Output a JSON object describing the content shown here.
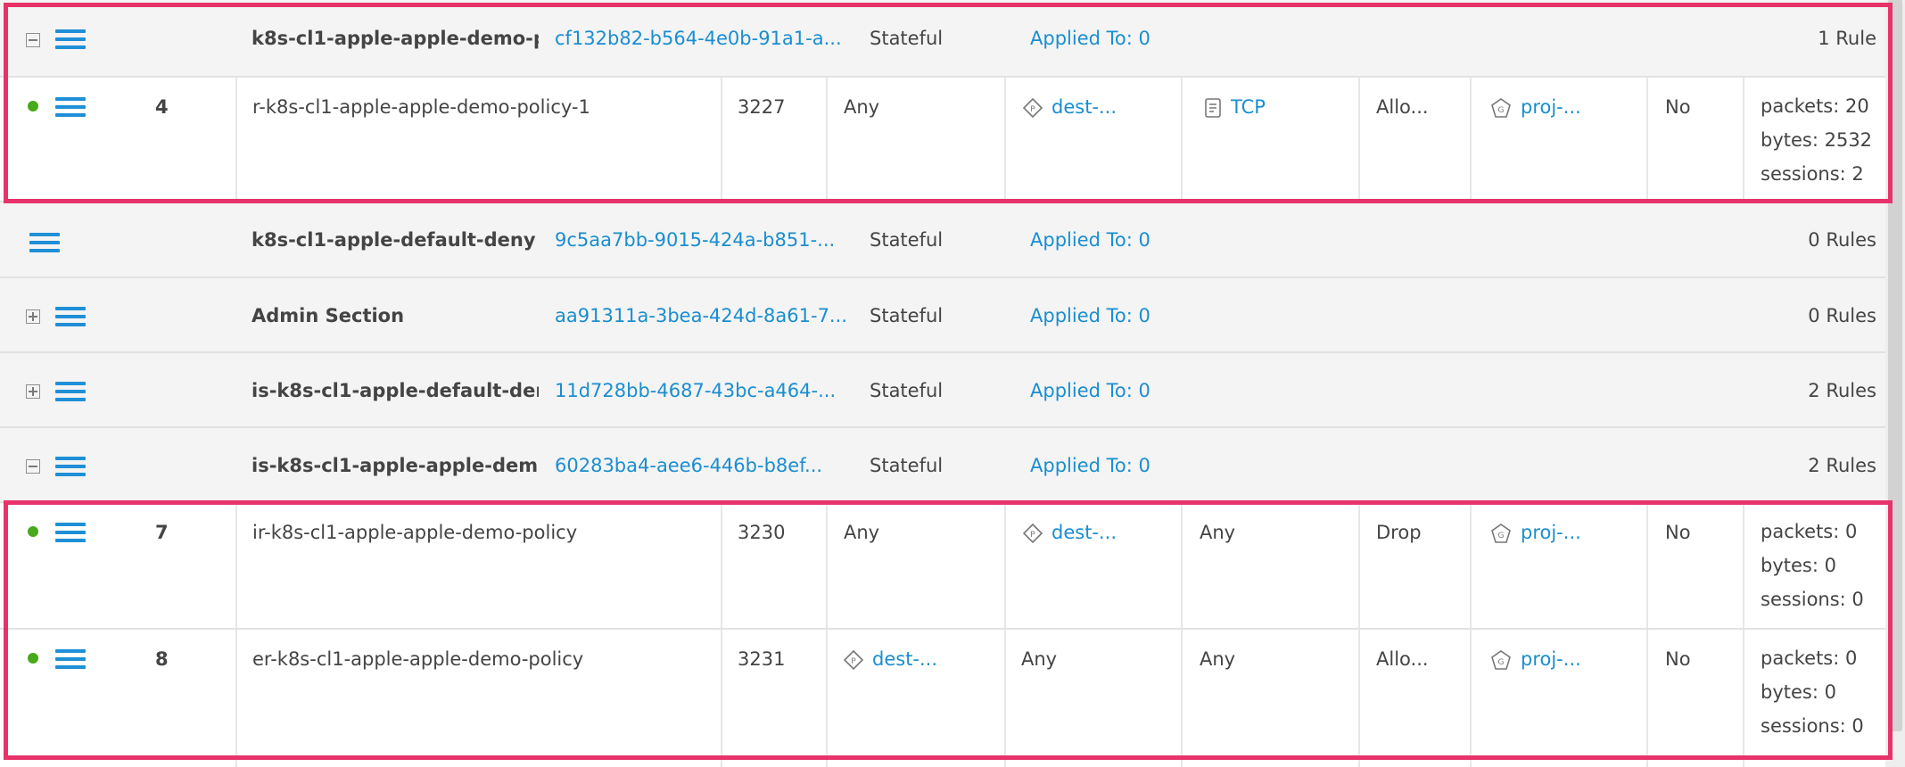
{
  "colors": {
    "accent": "#1f8fd8",
    "highlight": "#e7336a",
    "status_ok": "#48a91a"
  },
  "sections": [
    {
      "expander": "minus",
      "name": "k8s-cl1-apple-apple-demo-p",
      "id": "cf132b82-b564-4e0b-91a1-a...",
      "type": "Stateful",
      "applied": "Applied To: 0",
      "rules": "1 Rule"
    },
    {
      "expander": "none",
      "name": "k8s-cl1-apple-default-deny",
      "id": "9c5aa7bb-9015-424a-b851-...",
      "type": "Stateful",
      "applied": "Applied To: 0",
      "rules": "0 Rules"
    },
    {
      "expander": "plus",
      "name": "Admin Section",
      "id": "aa91311a-3bea-424d-8a61-7...",
      "type": "Stateful",
      "applied": "Applied To: 0",
      "rules": "0 Rules"
    },
    {
      "expander": "plus",
      "name": "is-k8s-cl1-apple-default-den",
      "id": "11d728bb-4687-43bc-a464-...",
      "type": "Stateful",
      "applied": "Applied To: 0",
      "rules": "2 Rules"
    },
    {
      "expander": "minus",
      "name": "is-k8s-cl1-apple-apple-demc",
      "id": "60283ba4-aee6-446b-b8ef...",
      "type": "Stateful",
      "applied": "Applied To: 0",
      "rules": "2 Rules"
    }
  ],
  "rules": [
    {
      "seq": "4",
      "name": "r-k8s-cl1-apple-apple-demo-policy-1",
      "rule_id": "3227",
      "sources": "Any",
      "destinations": "dest-...",
      "services": "TCP",
      "action": "Allo...",
      "applied_to": "proj-...",
      "logged": "No",
      "packets": "packets: 20",
      "bytes": "bytes: 2532",
      "sessions": "sessions: 2"
    },
    {
      "seq": "7",
      "name": "ir-k8s-cl1-apple-apple-demo-policy",
      "rule_id": "3230",
      "sources": "Any",
      "destinations": "dest-...",
      "services": "Any",
      "action": "Drop",
      "applied_to": "proj-...",
      "logged": "No",
      "packets": "packets: 0",
      "bytes": "bytes: 0",
      "sessions": "sessions: 0"
    },
    {
      "seq": "8",
      "name": "er-k8s-cl1-apple-apple-demo-policy",
      "rule_id": "3231",
      "sources": "dest-...",
      "destinations": "Any",
      "services": "Any",
      "action": "Allo...",
      "applied_to": "proj-...",
      "logged": "No",
      "packets": "packets: 0",
      "bytes": "bytes: 0",
      "sessions": "sessions: 0"
    }
  ]
}
